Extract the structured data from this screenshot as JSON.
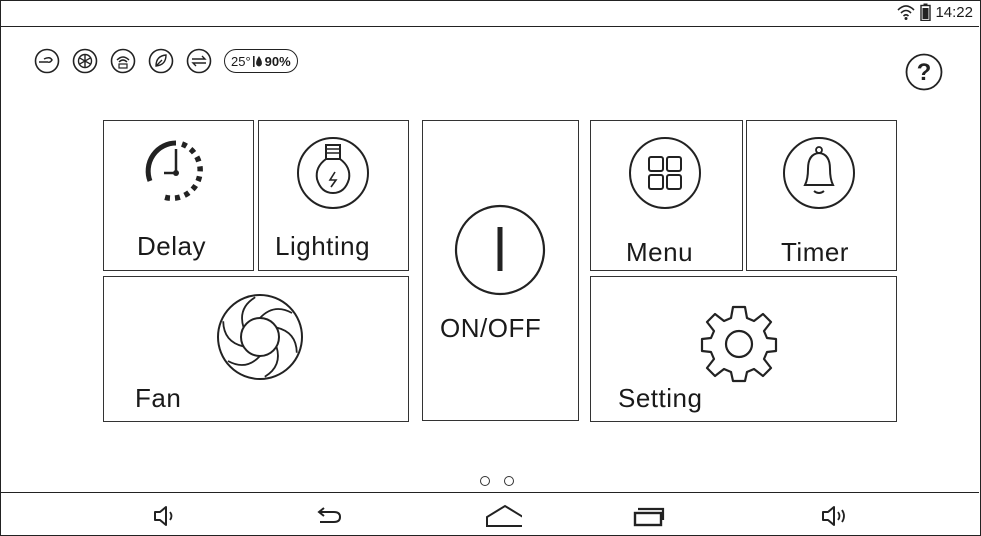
{
  "status": {
    "time": "14:22",
    "wifi_icon": "wifi-icon",
    "battery_icon": "battery-icon"
  },
  "indicators": {
    "icons": [
      "fan-mode-icon",
      "cycle-mode-icon",
      "signal-mode-icon",
      "eco-leaf-icon",
      "swing-arrows-icon"
    ],
    "temperature": "25°",
    "humidity": "90%"
  },
  "help": {
    "icon": "help-icon",
    "label": "?"
  },
  "tiles": {
    "delay": "Delay",
    "lighting": "Lighting",
    "onoff": "ON/OFF",
    "menu": "Menu",
    "timer": "Timer",
    "fan": "Fan",
    "setting": "Setting"
  },
  "pager": {
    "pages": 2
  },
  "nav": [
    "volume-down-icon",
    "back-icon",
    "home-icon",
    "recent-apps-icon",
    "volume-up-icon"
  ]
}
